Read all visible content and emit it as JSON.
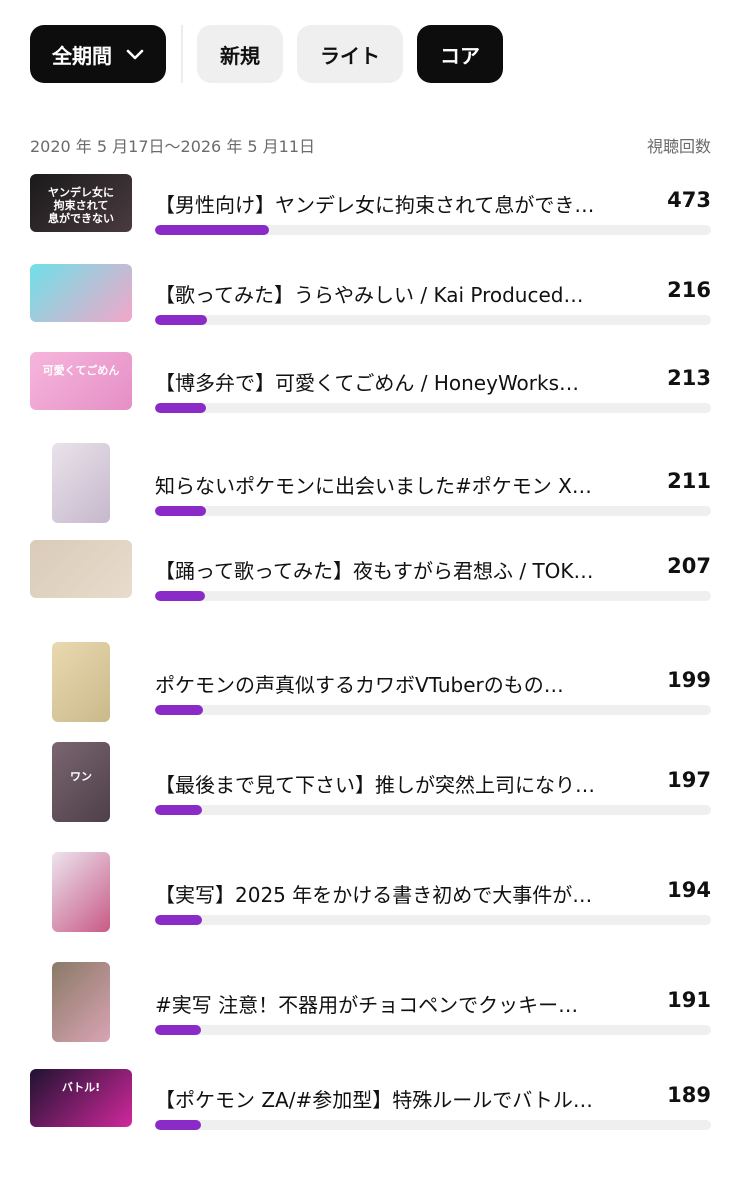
{
  "filters": {
    "period_label": "全期間",
    "new_label": "新規",
    "lite_label": "ライト",
    "core_label": "コア"
  },
  "range": {
    "dates": "2020 年 5 月17日～2026 年 5 月11日",
    "metric_label": "視聴回数"
  },
  "videos": [
    {
      "title": "【男性向け】ヤンデレ女に拘束されて息ができ…",
      "views": "473",
      "share": 0.205,
      "thumb": "wide",
      "thumb_text": "ヤンデレ女に\n拘束されて\n息ができない",
      "palette": [
        "#1a1a1a",
        "#4a3a40"
      ]
    },
    {
      "title": "【歌ってみた】うらやみしい / Kai Produced…",
      "views": "216",
      "share": 0.094,
      "thumb": "wide",
      "thumb_text": "",
      "palette": [
        "#6fe0e8",
        "#f2a6c8"
      ]
    },
    {
      "title": "【博多弁で】可愛くてごめん / HoneyWorks【…",
      "views": "213",
      "share": 0.092,
      "thumb": "wide",
      "thumb_text": "可愛くてごめん",
      "palette": [
        "#f6b6dc",
        "#e58fc6"
      ]
    },
    {
      "title": "知らないポケモンに出会いました#ポケモン X…",
      "views": "211",
      "share": 0.091,
      "thumb": "tall",
      "thumb_text": "",
      "palette": [
        "#e9e2ea",
        "#c6b8cc"
      ]
    },
    {
      "title": "【踊って歌ってみた】夜もすがら君想ふ / TOK…",
      "views": "207",
      "share": 0.09,
      "thumb": "wide",
      "thumb_text": "",
      "palette": [
        "#d9cbb8",
        "#e9dccc"
      ]
    },
    {
      "title": "ポケモンの声真似するカワボVTuberのもの…",
      "views": "199",
      "share": 0.086,
      "thumb": "tall",
      "thumb_text": "",
      "palette": [
        "#ead9b0",
        "#c9b98a"
      ]
    },
    {
      "title": "【最後まで見て下さい】推しが突然上司になり…",
      "views": "197",
      "share": 0.085,
      "thumb": "tall",
      "thumb_text": "ワン",
      "palette": [
        "#7a6670",
        "#4e3f48"
      ]
    },
    {
      "title": "【実写】2025 年をかける書き初めで大事件が…",
      "views": "194",
      "share": 0.084,
      "thumb": "tall",
      "thumb_text": "",
      "palette": [
        "#ece4ee",
        "#c85a86"
      ]
    },
    {
      "title": "#実写 注意！不器用がチョコペンでクッキー…",
      "views": "191",
      "share": 0.083,
      "thumb": "tall",
      "thumb_text": "",
      "palette": [
        "#8a7a66",
        "#d9a4b4"
      ]
    },
    {
      "title": "【ポケモン ZA/#参加型】特殊ルールでバトル…",
      "views": "189",
      "share": 0.082,
      "thumb": "wide",
      "thumb_text": "バトル!",
      "palette": [
        "#1f1230",
        "#d0289c"
      ]
    }
  ]
}
